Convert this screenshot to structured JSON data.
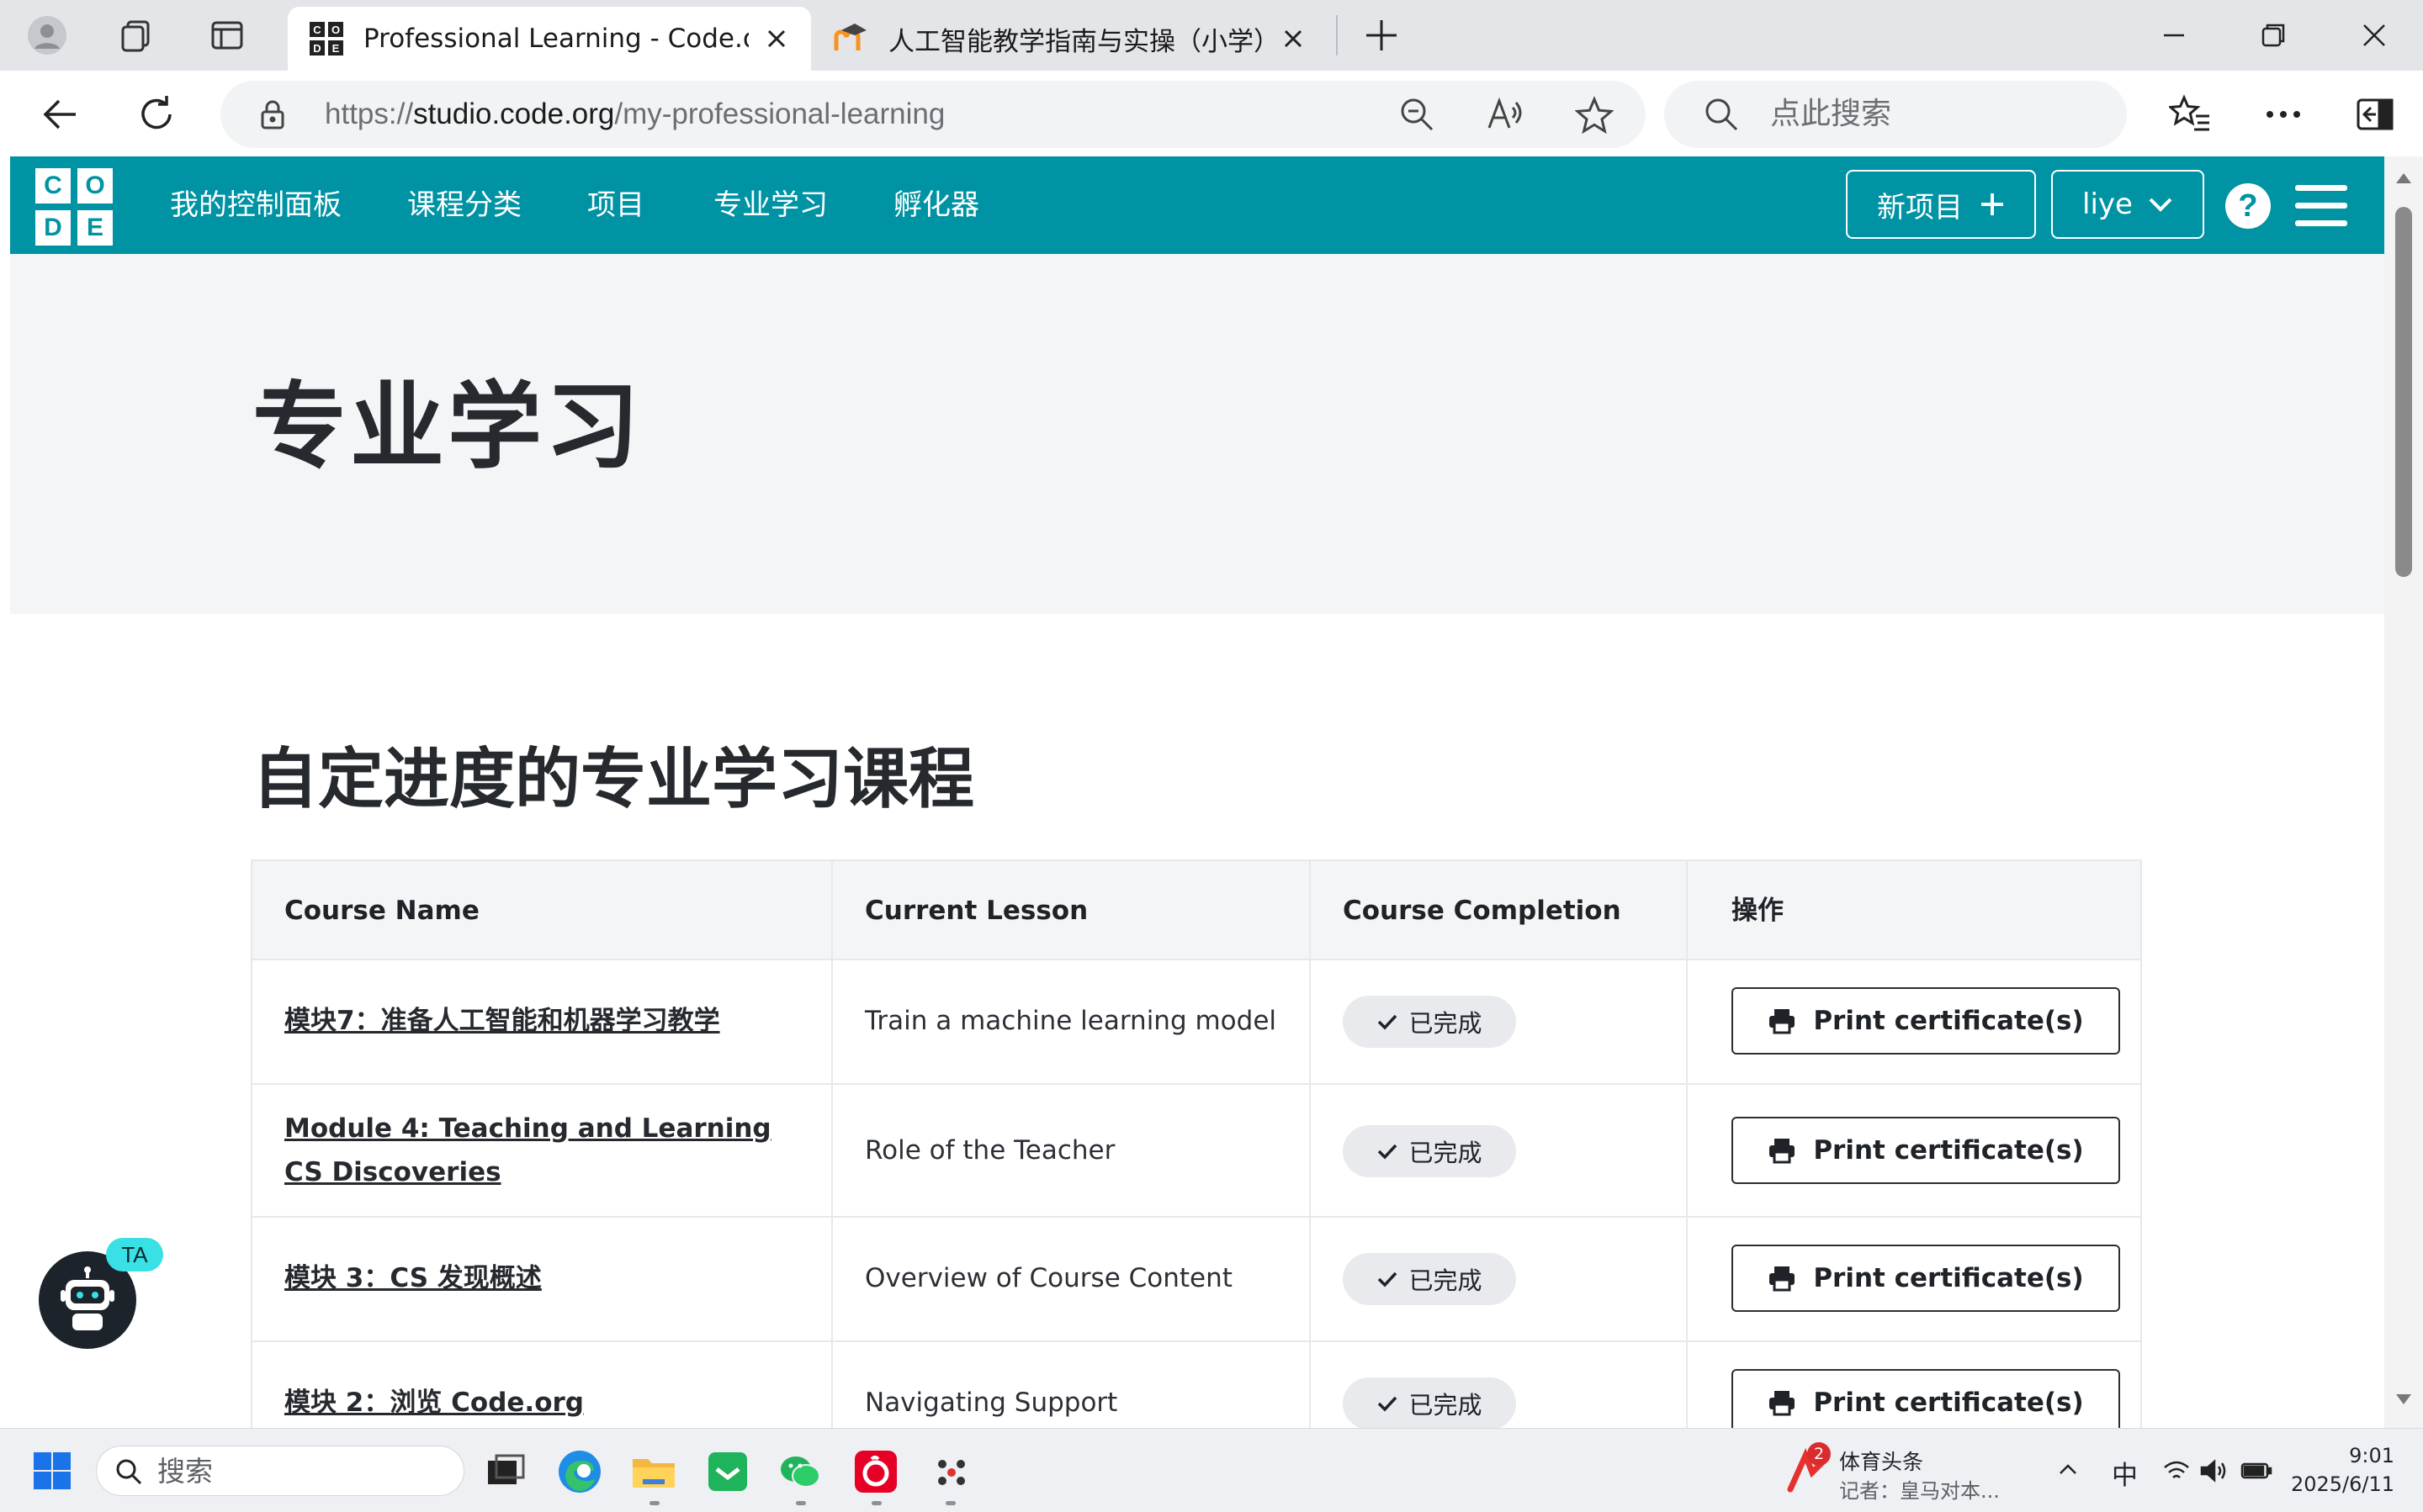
{
  "browser": {
    "tabs": [
      {
        "title": "Professional Learning - Code.org",
        "active": true
      },
      {
        "title": "人工智能教学指南与实操（小学）",
        "active": false
      }
    ],
    "url_prefix": "https://",
    "url_host": "studio.code.org",
    "url_path": "/my-professional-learning",
    "search_placeholder": "点此搜索"
  },
  "header": {
    "logo_letters": [
      "C",
      "O",
      "D",
      "E"
    ],
    "nav": [
      "我的控制面板",
      "课程分类",
      "项目",
      "专业学习",
      "孵化器"
    ],
    "new_project_label": "新项目",
    "user_label": "liye",
    "help_label": "?"
  },
  "hero": {
    "title": "专业学习"
  },
  "section": {
    "title": "自定进度的专业学习课程",
    "columns": [
      "Course Name",
      "Current Lesson",
      "Course Completion",
      "操作"
    ],
    "rows": [
      {
        "course": "模块7：准备人工智能和机器学习教学",
        "lesson": "Train a machine learning model",
        "status": "已完成",
        "action": "Print certificate(s)"
      },
      {
        "course": "Module 4: Teaching and Learning CS Discoveries",
        "lesson": "Role of the Teacher",
        "status": "已完成",
        "action": "Print certificate(s)"
      },
      {
        "course": "模块 3：CS 发现概述",
        "lesson": "Overview of Course Content",
        "status": "已完成",
        "action": "Print certificate(s)"
      },
      {
        "course": "模块 2：浏览 Code.org",
        "lesson": "Navigating Support",
        "status": "已完成",
        "action": "Print certificate(s)"
      }
    ]
  },
  "ta_bot": {
    "badge": "TA"
  },
  "taskbar": {
    "search_placeholder": "搜索",
    "news_title": "体育头条",
    "news_subtitle": "记者：皇马对本...",
    "news_badge": "2",
    "ime": "中",
    "time": "9:01",
    "date": "2025/6/11"
  },
  "colors": {
    "brand": "#0093a4",
    "hero_bg": "#f3f5f7",
    "badge_bg": "#e8eaed"
  }
}
